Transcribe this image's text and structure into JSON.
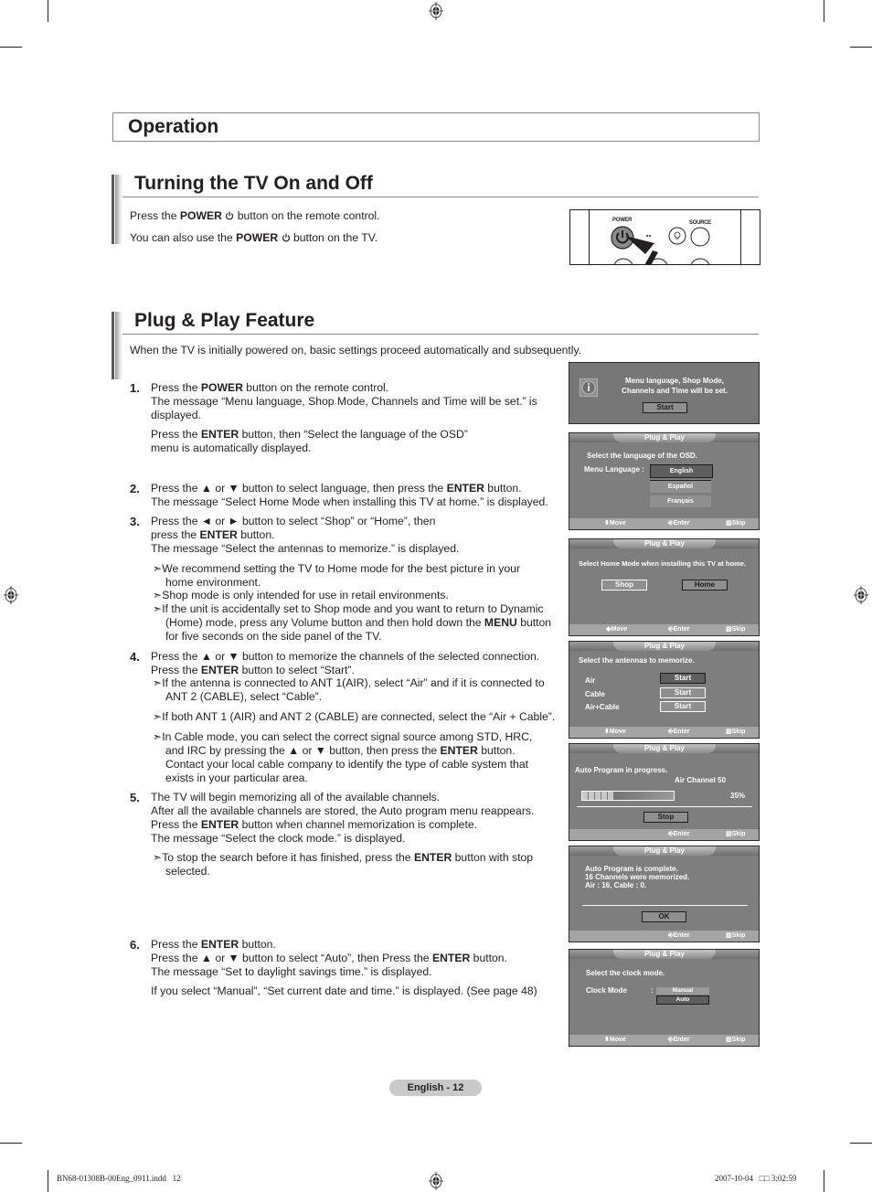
{
  "header": {
    "chapter_title": "Operation"
  },
  "turning_on_off": {
    "title": "Turning the TV On and Off",
    "line1": {
      "pre": "Press the ",
      "bold": "POWER",
      "icon": "power-icon",
      "post": " button on the remote control."
    },
    "line2": {
      "pre": "You can also use the ",
      "bold": "POWER",
      "icon": "power-icon",
      "post": " button on the TV."
    },
    "remote_image": {
      "power_label": "POWER",
      "source_label": "SOURCE"
    }
  },
  "plug_and_play": {
    "title": "Plug & Play Feature",
    "intro": "When the TV is initially powered on, basic settings proceed automatically and subsequently.",
    "steps": [
      {
        "number": "1.",
        "lines": [
          {
            "pre": "Press the ",
            "bold": "POWER",
            "post": " button on the remote control."
          },
          {
            "pre": "The message “Menu language, Shop Mode, Channels and Time will be set.” is displayed.",
            "bold": "",
            "post": ""
          }
        ],
        "extra": {
          "pre": "Press the ",
          "bold": "ENTER",
          "post": " button, then “Select the language of the OSD” menu is automatically displayed."
        },
        "notes": []
      },
      {
        "number": "2.",
        "lines": [
          {
            "pre": "Press the ▲ or ▼ button to select language, then press the ",
            "bold": "ENTER",
            "post": " button."
          },
          {
            "pre": "The message “Select Home Mode when installing this TV at home.” is displayed.",
            "bold": "",
            "post": ""
          }
        ],
        "notes": []
      },
      {
        "number": "3.",
        "lines": [
          {
            "pre": "Press the ◄ or ► button to select “Shop” or “Home”, then",
            "bold": "",
            "post": ""
          },
          {
            "pre": "press the ",
            "bold": "ENTER",
            "post": " button."
          },
          {
            "pre": "The message “Select the antennas to memorize.” is displayed.",
            "bold": "",
            "post": ""
          }
        ],
        "notes": [
          {
            "pre": "We recommend setting the TV to Home mode for the best picture in your home environment.",
            "bold": "",
            "post": ""
          },
          {
            "pre": "Shop mode is only intended for use in retail environments.",
            "bold": "",
            "post": ""
          },
          {
            "pre": "If the unit is accidentally set to Shop mode and you want to return to Dynamic (Home) mode, press any Volume button and then hold down the ",
            "bold": "MENU",
            "post": " button for five seconds on the side panel of the TV."
          }
        ]
      },
      {
        "number": "4.",
        "lines": [
          {
            "pre": "Press the ▲ or ▼ button to memorize the channels of the selected connection.",
            "bold": "",
            "post": ""
          },
          {
            "pre": "Press the ",
            "bold": "ENTER",
            "post": " button to select “Start”."
          }
        ],
        "notes": [
          {
            "pre": "If the antenna is connected to ANT 1(AIR), select “Air” and if it is connected to ANT 2 (CABLE), select “Cable”.",
            "bold": "",
            "post": ""
          },
          {
            "pre": "If both ANT 1 (AIR) and ANT 2 (CABLE) are connected, select the “Air + Cable”.",
            "bold": "",
            "post": ""
          },
          {
            "pre": "In Cable mode, you can select the correct signal source among STD, HRC, and IRC by pressing the ▲ or ▼ button, then press the ",
            "bold": "ENTER",
            "post": " button. Contact your local cable company to identify the type of cable system that exists in your particular area."
          }
        ]
      },
      {
        "number": "5.",
        "lines": [
          {
            "pre": "The TV will begin memorizing all of the available channels.",
            "bold": "",
            "post": ""
          },
          {
            "pre": "After all the available channels are stored, the Auto program menu reappears.",
            "bold": "",
            "post": ""
          },
          {
            "pre": "Press the ",
            "bold": "ENTER",
            "post": " button when channel memorization is complete."
          },
          {
            "pre": "The message “Select the clock mode.” is displayed.",
            "bold": "",
            "post": ""
          }
        ],
        "notes": [
          {
            "pre": "To stop the search before it has finished, press the ",
            "bold": "ENTER",
            "post": " button with stop selected."
          }
        ]
      },
      {
        "number": "6.",
        "lines": [
          {
            "pre": "Press the ",
            "bold": "ENTER",
            "post": " button."
          },
          {
            "pre": "Press the ▲ or ▼ button to select “Auto”, then Press the ",
            "bold": "ENTER",
            "post": " button."
          },
          {
            "pre": "The message “Set to daylight savings time.” is displayed.",
            "bold": "",
            "post": ""
          }
        ],
        "extra": {
          "pre": "If you select “Manual”, “Set current date and time.” is displayed. (See page 48)",
          "bold": "",
          "post": ""
        },
        "notes": []
      }
    ]
  },
  "osd_screens": {
    "welcome": {
      "icon": "info-icon",
      "message_line1": "Menu language, Shop Mode,",
      "message_line2": "Channels and Time will be set.",
      "button": "Start"
    },
    "language": {
      "title": "Plug & Play",
      "prompt": "Select the language of the OSD.",
      "label": "Menu Language :",
      "options": [
        "English",
        "Español",
        "Français"
      ],
      "selected": "English",
      "footer": {
        "move": "Move",
        "enter": "Enter",
        "skip": "Skip"
      }
    },
    "home_mode": {
      "title": "Plug & Play",
      "prompt": "Select Home Mode when installing this TV at home.",
      "options": [
        "Shop",
        "Home"
      ],
      "selected": "Home",
      "footer": {
        "move": "Move",
        "enter": "Enter",
        "skip": "Skip"
      }
    },
    "antennas": {
      "title": "Plug & Play",
      "prompt": "Select the antennas to memorize.",
      "rows": [
        {
          "label": "Air",
          "button": "Start"
        },
        {
          "label": "Cable",
          "button": "Start"
        },
        {
          "label": "Air+Cable",
          "button": "Start"
        }
      ],
      "selected_row": "Air",
      "footer": {
        "move": "Move",
        "enter": "Enter",
        "skip": "Skip"
      }
    },
    "auto_program": {
      "title": "Plug & Play",
      "status": "Auto Program in progress.",
      "channel": "Air Channel 50",
      "progress_percent": 35,
      "progress_label": "35%",
      "button": "Stop",
      "footer": {
        "enter": "Enter",
        "skip": "Skip"
      }
    },
    "complete": {
      "title": "Plug & Play",
      "line1": "Auto Program is complete.",
      "line2": "16 Channels were memorized.",
      "line3": "Air : 16, Cable : 0.",
      "button": "OK",
      "footer": {
        "enter": "Enter",
        "skip": "Skip"
      }
    },
    "clock": {
      "title": "Plug & Play",
      "prompt": "Select the clock mode.",
      "label": "Clock Mode",
      "colon": ":",
      "options": [
        "Manual",
        "Auto"
      ],
      "selected": "Auto",
      "footer": {
        "move": "Move",
        "enter": "Enter",
        "skip": "Skip"
      }
    }
  },
  "footer": {
    "page_label": "English - 12",
    "slug_left": "BN68-01308B-00Eng_0911.indd   12",
    "slug_right": "2007-10-04   □□ 3:02:59"
  }
}
